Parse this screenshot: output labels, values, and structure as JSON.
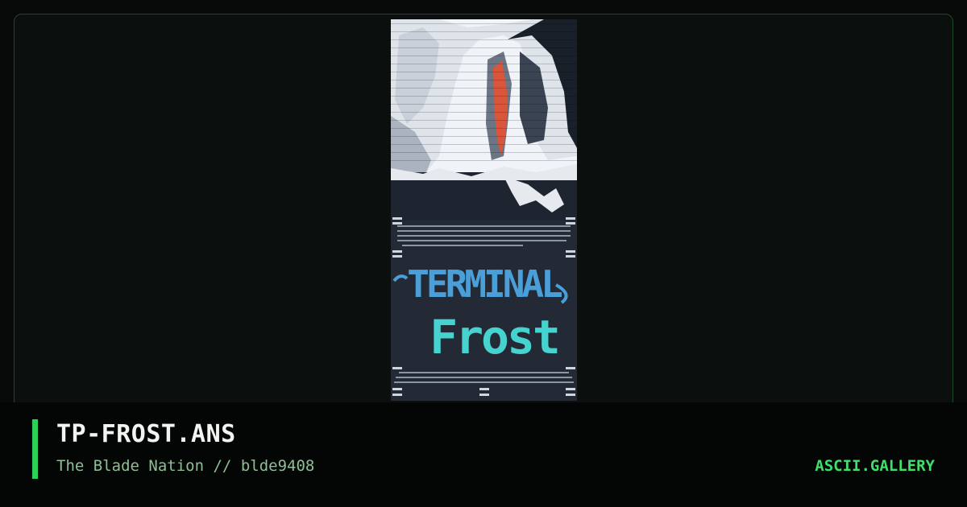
{
  "artwork": {
    "filename": "TP-FROST.ANS",
    "group": "The Blade Nation",
    "code": "blde9408",
    "separator": "//",
    "logo_word_1": "TERMINAL",
    "logo_word_2": "Frost"
  },
  "site": {
    "brand": "ASCII.GALLERY"
  },
  "colors": {
    "accent": "#2ad157",
    "brand_text": "#3fe06a",
    "subtitle_text": "#8fbf95",
    "art_background": "#232a36",
    "logo_blue": "#4a9fd8",
    "logo_cyan": "#46d2cf",
    "face_red": "#d9553c"
  }
}
